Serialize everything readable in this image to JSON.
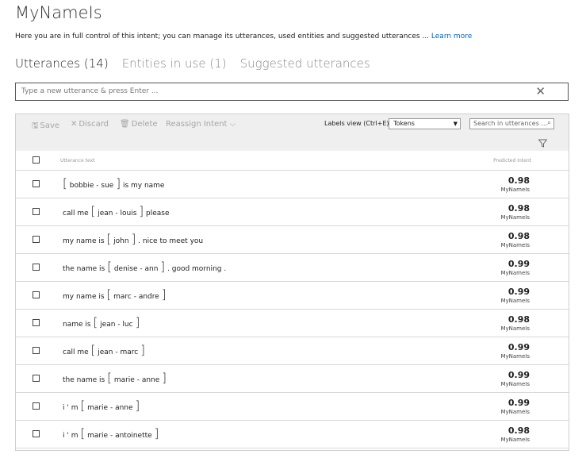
{
  "page": {
    "title": "MyNameIs",
    "description": "Here you are in full control of this intent; you can manage its utterances, used entities and suggested utterances ...",
    "learn_more": "Learn more"
  },
  "tabs": [
    {
      "label": "Utterances (14)",
      "active": true
    },
    {
      "label": "Entities in use (1)",
      "active": false
    },
    {
      "label": "Suggested utterances",
      "active": false
    }
  ],
  "utterance_input": {
    "placeholder": "Type a new utterance & press Enter ...",
    "clear_icon": "close-icon"
  },
  "toolbar": {
    "save": "Save",
    "discard": "Discard",
    "delete": "Delete",
    "reassign": "Reassign Intent",
    "labels_view_label": "Labels view (Ctrl+E):",
    "labels_view_value": "Tokens",
    "search_placeholder": "Search in utterances ..."
  },
  "table": {
    "col_text": "Utterance text",
    "col_intent": "Predicted Intent",
    "rows": [
      {
        "pre": "",
        "entity": "bobbie - sue",
        "post": "is my name",
        "score": "0.98",
        "intent": "MyNameIs"
      },
      {
        "pre": "call me",
        "entity": "jean - louis",
        "post": "please",
        "score": "0.98",
        "intent": "MyNameIs"
      },
      {
        "pre": "my name is",
        "entity": "john",
        "post": ". nice to meet you",
        "score": "0.98",
        "intent": "MyNameIs"
      },
      {
        "pre": "the name is",
        "entity": "denise - ann",
        "post": ". good morning .",
        "score": "0.99",
        "intent": "MyNameIs"
      },
      {
        "pre": "my name is",
        "entity": "marc - andre",
        "post": "",
        "score": "0.99",
        "intent": "MyNameIs"
      },
      {
        "pre": "name is",
        "entity": "jean - luc",
        "post": "",
        "score": "0.98",
        "intent": "MyNameIs"
      },
      {
        "pre": "call me",
        "entity": "jean - marc",
        "post": "",
        "score": "0.99",
        "intent": "MyNameIs"
      },
      {
        "pre": "the name is",
        "entity": "marie - anne",
        "post": "",
        "score": "0.99",
        "intent": "MyNameIs"
      },
      {
        "pre": "i ' m",
        "entity": "marie - anne",
        "post": "",
        "score": "0.99",
        "intent": "MyNameIs"
      },
      {
        "pre": "i ' m",
        "entity": "marie - antoinette",
        "post": "",
        "score": "0.98",
        "intent": "MyNameIs"
      }
    ]
  }
}
